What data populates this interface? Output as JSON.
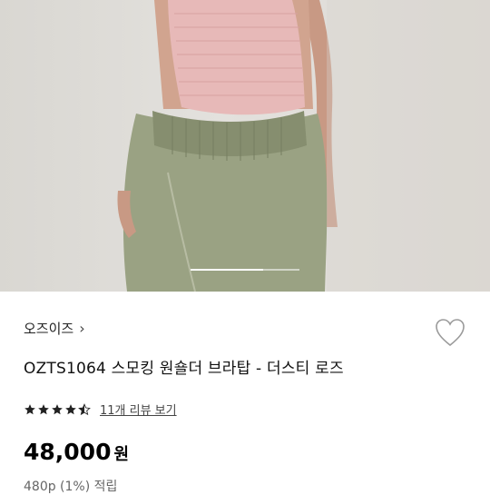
{
  "product_image": {
    "alt": "",
    "slide_index": 1,
    "slide_fraction": 0.67
  },
  "brand": {
    "name": "오즈이즈",
    "chevron": "›",
    "icon": "chevron-right-icon"
  },
  "wishlist": {
    "icon": "heart-outline-icon"
  },
  "product": {
    "title": "OZTS1064 스모킹 원숄더 브라탑 - 더스티 로즈"
  },
  "rating": {
    "stars": 4.5,
    "reviews_label": "11개 리뷰 보기"
  },
  "price": {
    "amount": "48,000",
    "currency": "원"
  },
  "points": {
    "label": "480p (1%) 적립"
  },
  "colors": {
    "top": "#e7b9b8",
    "pants": "#9aa283",
    "skin": "#c99a84",
    "star": "#222222"
  }
}
